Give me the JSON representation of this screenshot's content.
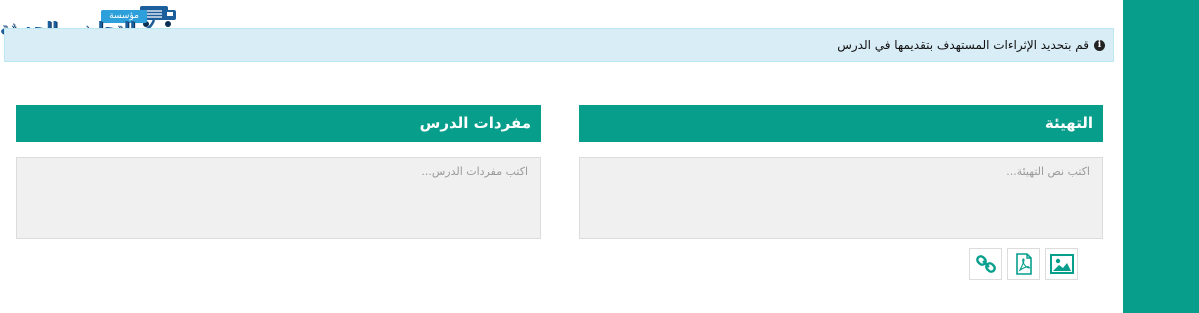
{
  "logo": {
    "subtitle": "مؤسسة",
    "title": "التحاضير الحديثة"
  },
  "alert": {
    "icon": "info-circle-icon",
    "text": "قم بتحديد الإثراءات المستهدف بتقديمها في الدرس"
  },
  "panels": {
    "warmup": {
      "title": "التهيئة",
      "placeholder": "اكتب نص التهيئة..."
    },
    "vocabulary": {
      "title": "مفردات الدرس",
      "placeholder": "اكتب مفردات الدرس..."
    }
  },
  "toolbar": {
    "buttons": [
      "image-icon",
      "pdf-icon",
      "link-icon"
    ]
  },
  "colors": {
    "accent": "#079e8c",
    "alert_bg": "#d9edf7",
    "alert_border": "#bce8f1",
    "input_bg": "#f0f0f0"
  }
}
